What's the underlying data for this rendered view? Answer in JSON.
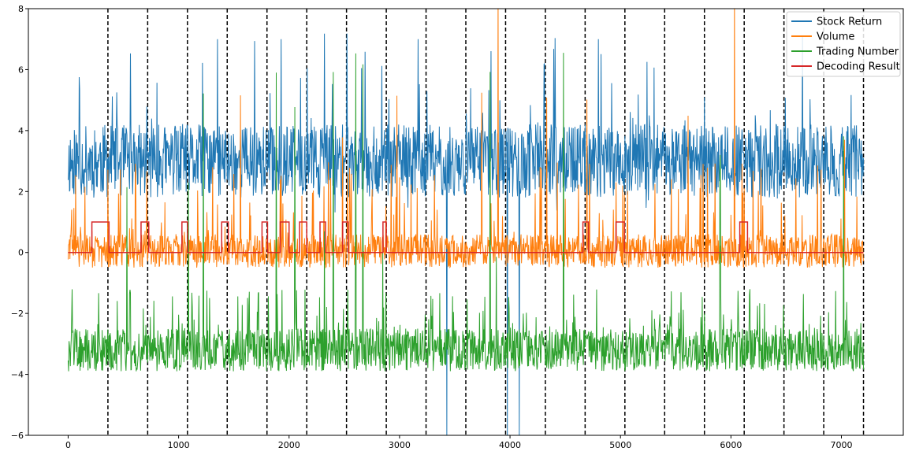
{
  "chart_data": {
    "type": "line",
    "title": "",
    "xlabel": "",
    "ylabel": "",
    "xlim": [
      -360,
      7560
    ],
    "ylim": [
      -6,
      8
    ],
    "x_ticks": [
      0,
      1000,
      2000,
      3000,
      4000,
      5000,
      6000,
      7000
    ],
    "x_tick_labels": [
      "0",
      "1000",
      "2000",
      "3000",
      "4000",
      "5000",
      "6000",
      "7000"
    ],
    "y_ticks": [
      -6,
      -4,
      -2,
      0,
      2,
      4,
      6,
      8
    ],
    "y_tick_labels": [
      "−6",
      "−4",
      "−2",
      "0",
      "2",
      "4",
      "6",
      "8"
    ],
    "n_points": 7200,
    "legend_position": "top-right",
    "colors": {
      "Stock Return": "#1f77b4",
      "Volume": "#ff7f0e",
      "Trading Number": "#2ca02c",
      "Decoding Result": "#d62728",
      "boundaries": "#000000"
    },
    "legend": [
      "Stock Return",
      "Volume",
      "Trading Number",
      "Decoding Result"
    ],
    "series": [
      {
        "name": "Stock Return",
        "baseline": 3.0,
        "typical_range": [
          1.8,
          4.5
        ],
        "peak_max": 7.0,
        "trough_min": -6.0
      },
      {
        "name": "Volume",
        "baseline": 0.0,
        "typical_range": [
          -0.6,
          1.5
        ],
        "peak_max": 8.0
      },
      {
        "name": "Trading Number",
        "baseline": -3.2,
        "typical_range": [
          -4.0,
          -1.5
        ],
        "peak_max": 8.0
      },
      {
        "name": "Decoding Result",
        "values_step": [
          [
            0,
            0
          ],
          [
            215,
            1
          ],
          [
            370,
            0
          ],
          [
            660,
            1
          ],
          [
            730,
            0
          ],
          [
            1030,
            1
          ],
          [
            1080,
            0
          ],
          [
            1390,
            1
          ],
          [
            1450,
            0
          ],
          [
            1755,
            1
          ],
          [
            1805,
            0
          ],
          [
            1920,
            1
          ],
          [
            2000,
            0
          ],
          [
            2095,
            1
          ],
          [
            2160,
            0
          ],
          [
            2280,
            1
          ],
          [
            2330,
            0
          ],
          [
            2485,
            1
          ],
          [
            2535,
            0
          ],
          [
            2850,
            1
          ],
          [
            2880,
            0
          ],
          [
            4660,
            1
          ],
          [
            4710,
            0
          ],
          [
            4960,
            1
          ],
          [
            5035,
            0
          ],
          [
            6080,
            1
          ],
          [
            6150,
            0
          ],
          [
            7200,
            0
          ]
        ]
      }
    ],
    "boundaries": [
      360,
      720,
      1080,
      1440,
      1800,
      2160,
      2520,
      2880,
      3240,
      3600,
      3960,
      4320,
      4680,
      5040,
      5400,
      5760,
      6120,
      6480,
      6840,
      7200
    ]
  }
}
